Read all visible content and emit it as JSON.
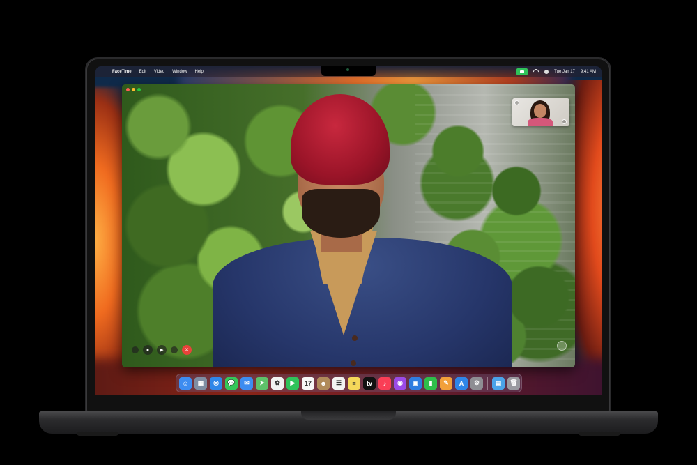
{
  "menubar": {
    "app_name": "FaceTime",
    "menus": [
      "Edit",
      "Video",
      "Window",
      "Help"
    ],
    "date": "Tue Jan 17",
    "time": "9:41 AM"
  },
  "icons": {
    "apple": "",
    "video": "▶",
    "mic": "🎤",
    "end": "✕"
  },
  "colors": {
    "facetime_green": "#30c35a",
    "end_call_red": "#e8433a",
    "turban_red": "#9a1428",
    "sweater_navy": "#26366a"
  },
  "dock": {
    "apps": [
      {
        "name": "finder-icon",
        "color": "#3d8cf0",
        "glyph": "☺"
      },
      {
        "name": "launchpad-icon",
        "color": "#7f8ea3",
        "glyph": "▦"
      },
      {
        "name": "safari-icon",
        "color": "#2f86e8",
        "glyph": "◎"
      },
      {
        "name": "messages-icon",
        "color": "#35c759",
        "glyph": "💬"
      },
      {
        "name": "mail-icon",
        "color": "#3d8cf0",
        "glyph": "✉"
      },
      {
        "name": "maps-icon",
        "color": "#5ec26a",
        "glyph": "➤"
      },
      {
        "name": "photos-icon",
        "color": "#f2f2f2",
        "glyph": "✿"
      },
      {
        "name": "facetime-icon",
        "color": "#30c35a",
        "glyph": "▶"
      },
      {
        "name": "calendar-icon",
        "color": "#f7f7f7",
        "glyph": "17"
      },
      {
        "name": "contacts-icon",
        "color": "#b08a5a",
        "glyph": "☻"
      },
      {
        "name": "reminders-icon",
        "color": "#f2f2f2",
        "glyph": "☰"
      },
      {
        "name": "notes-icon",
        "color": "#f5d85a",
        "glyph": "≡"
      },
      {
        "name": "apple-tv-icon",
        "color": "#111111",
        "glyph": "tv"
      },
      {
        "name": "music-icon",
        "color": "#fa3e56",
        "glyph": "♪"
      },
      {
        "name": "podcasts-icon",
        "color": "#9b4ae6",
        "glyph": "◉"
      },
      {
        "name": "keynote-icon",
        "color": "#2f7de0",
        "glyph": "▣"
      },
      {
        "name": "numbers-icon",
        "color": "#2fbf4a",
        "glyph": "▮"
      },
      {
        "name": "pages-icon",
        "color": "#f2a03a",
        "glyph": "✎"
      },
      {
        "name": "app-store-icon",
        "color": "#2f86e8",
        "glyph": "A"
      },
      {
        "name": "system-settings-icon",
        "color": "#8e8e93",
        "glyph": "⚙"
      }
    ],
    "extras": [
      {
        "name": "downloads-folder-icon",
        "color": "#4aa3e8",
        "glyph": "▤"
      },
      {
        "name": "trash-icon",
        "color": "#9a9aa0",
        "glyph": "🗑"
      }
    ]
  }
}
